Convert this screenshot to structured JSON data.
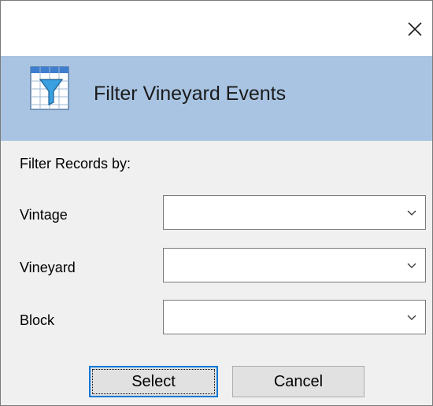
{
  "window": {
    "close_icon": "close-icon"
  },
  "banner": {
    "title": "Filter Vineyard Events",
    "icon": "filter-table-icon",
    "bg_color": "#a9c4e2"
  },
  "form": {
    "section_label": "Filter Records by:",
    "fields": [
      {
        "label": "Vintage",
        "value": ""
      },
      {
        "label": "Vineyard",
        "value": ""
      },
      {
        "label": "Block",
        "value": ""
      }
    ]
  },
  "buttons": {
    "select": "Select",
    "cancel": "Cancel"
  },
  "colors": {
    "accent": "#0078d7"
  }
}
